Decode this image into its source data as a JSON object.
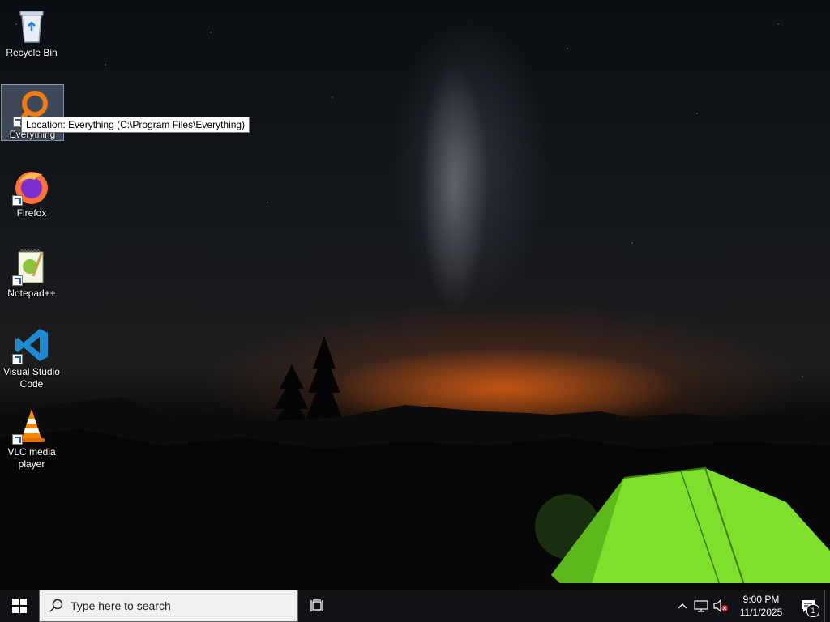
{
  "desktop": {
    "icons": [
      {
        "label": "Recycle Bin",
        "icon": "recycle-bin-icon"
      },
      {
        "label": "Everything",
        "icon": "everything-search-icon"
      },
      {
        "label": "Firefox",
        "icon": "firefox-icon"
      },
      {
        "label": "Notepad++",
        "icon": "notepad-plus-plus-icon"
      },
      {
        "label": "Visual Studio Code",
        "icon": "vscode-icon"
      },
      {
        "label": "VLC media player",
        "icon": "vlc-icon"
      }
    ],
    "tooltip": "Location: Everything (C:\\Program Files\\Everything)"
  },
  "taskbar": {
    "search_placeholder": "Type here to search",
    "time": "9:00 PM",
    "date": "11/1/2025",
    "notification_count": "1"
  },
  "colors": {
    "taskbar": "#101217",
    "tent": "#7ee02a",
    "horizon_glow": "#ff6e14"
  }
}
